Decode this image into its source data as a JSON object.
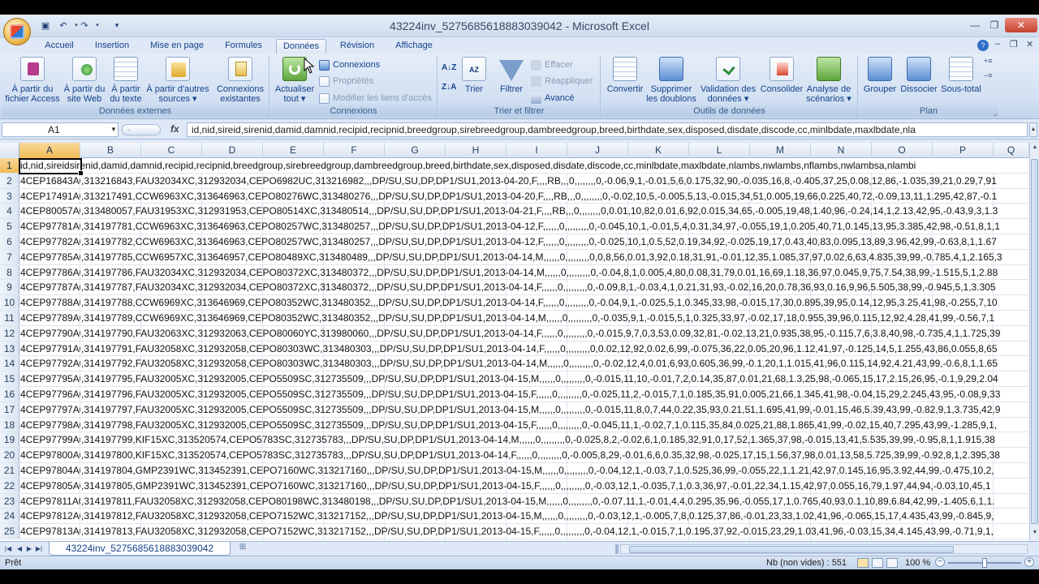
{
  "window": {
    "title": "43224inv_5275685618883039042 - Microsoft Excel"
  },
  "tabs": [
    {
      "label": "Accueil"
    },
    {
      "label": "Insertion"
    },
    {
      "label": "Mise en page"
    },
    {
      "label": "Formules"
    },
    {
      "label": "Données",
      "active": true
    },
    {
      "label": "Révision"
    },
    {
      "label": "Affichage"
    }
  ],
  "ribbon": {
    "external": {
      "label": "Données externes",
      "access": "À partir du fichier Access",
      "access_l1": "À partir du",
      "access_l2": "fichier Access",
      "web_l1": "À partir du",
      "web_l2": "site Web",
      "text_l1": "À partir",
      "text_l2": "du texte",
      "other_l1": "À partir d'autres",
      "other_l2": "sources ▾",
      "existing_l1": "Connexions",
      "existing_l2": "existantes"
    },
    "connections": {
      "label": "Connexions",
      "refresh_l1": "Actualiser",
      "refresh_l2": "tout ▾",
      "connections": "Connexions",
      "properties": "Propriétés",
      "edit_links": "Modifier les liens d'accès"
    },
    "sort_filter": {
      "label": "Trier et filtrer",
      "sort": "Trier",
      "filter": "Filtrer",
      "clear": "Effacer",
      "reapply": "Réappliquer",
      "advanced": "Avancé"
    },
    "data_tools": {
      "label": "Outils de données",
      "convert": "Convertir",
      "remove_dup_l1": "Supprimer",
      "remove_dup_l2": "les doublons",
      "validation_l1": "Validation des",
      "validation_l2": "données ▾",
      "consolidate": "Consolider",
      "whatif_l1": "Analyse de",
      "whatif_l2": "scénarios ▾"
    },
    "outline": {
      "label": "Plan",
      "group": "Grouper",
      "ungroup": "Dissocier",
      "subtotal": "Sous-total"
    }
  },
  "formula_bar": {
    "name_box": "A1",
    "fx": "fx",
    "formula": "id,nid,sireid,sirenid,damid,damnid,recipid,recipnid,breedgroup,sirebreedgroup,dambreedgroup,breed,birthdate,sex,disposed,disdate,discode,cc,minlbdate,maxlbdate,nla"
  },
  "columns": [
    "A",
    "B",
    "C",
    "D",
    "E",
    "F",
    "G",
    "H",
    "I",
    "J",
    "K",
    "L",
    "M",
    "N",
    "O",
    "P",
    "Q"
  ],
  "rows": [
    {
      "n": "1",
      "a": "id,nid,sireid",
      "rest": "sirenid,damid,damnid,recipid,recipnid,breedgroup,sirebreedgroup,dambreedgroup,breed,birthdate,sex,disposed,disdate,discode,cc,minlbdate,maxlbdate,nlambs,nwlambs,nflambs,nwlambsa,nlambi"
    },
    {
      "n": "2",
      "a": "4CEP16843A0",
      "rest": ",313216843,FAU32034XC,312932034,CEPO6982UC,313216982,,,DP/SU,SU,DP,DP1/SU1,2013-04-20,F,,,,RB,,,0,,,,,,,,0,-0.06,9,1,-0.01,5,6,0.175,32,90,-0.035,16,8,-0.405,37,25,0.08,12,86,-1.035,39,21,0.29,7,91"
    },
    {
      "n": "3",
      "a": "4CEP17491A0",
      "rest": ",313217491,CCW6963XC,313646963,CEPO80276WC,313480276,,,DP/SU,SU,DP,DP1/SU1,2013-04-20,F,,,,RB,,,0,,,,,,,,0,-0.02,10,5,-0.005,5,13,-0.015,34,51,0.005,19,66,0.225,40,72,-0.09,13,11,1.295,42,87,-0.1"
    },
    {
      "n": "4",
      "a": "4CEP80057A0",
      "rest": ",313480057,FAU31953XC,312931953,CEPO80514XC,313480514,,,DP/SU,SU,DP,DP1/SU1,2013-04-21,F,,,,RB,,,0,,,,,,,,0,0.01,10,82,0.01,6,92,0.015,34,65,-0.005,19,48,1.40,96,-0.24,14,1,2.13,42,95,-0.43,9,3,1.3"
    },
    {
      "n": "5",
      "a": "4CEP97781A0",
      "rest": ",314197781,CCW6963XC,313646963,CEPO80257WC,313480257,,,DP/SU,SU,DP,DP1/SU1,2013-04-12,F,,,,,,0,,,,,,,,,0,-0.045,10,1,-0.01,5,4,0.31,34,97,-0.055,19,1,0.205,40,71,0.145,13,95,3.385,42,98,-0.51,8,1,1"
    },
    {
      "n": "6",
      "a": "4CEP97782A0",
      "rest": ",314197782,CCW6963XC,313646963,CEPO80257WC,313480257,,,DP/SU,SU,DP,DP1/SU1,2013-04-12,F,,,,,,0,,,,,,,,,0,-0.025,10,1,0.5,52,0.19,34,92,-0.025,19,17,0.43,40,83,0.095,13,89,3.96,42,99,-0.63,8,1,1.67"
    },
    {
      "n": "7",
      "a": "4CEP97785A0",
      "rest": ",314197785,CCW6957XC,313646957,CEPO80489XC,313480489,,,DP/SU,SU,DP,DP1/SU1,2013-04-14,M,,,,,,0,,,,,,,,,0,0,8,56,0.01,3,92,0.18,31,91,-0.01,12,35,1.085,37,97,0.02,6,63,4.835,39,99,-0.785,4,1,2.165,3"
    },
    {
      "n": "8",
      "a": "4CEP97786A0",
      "rest": ",314197786,FAU32034XC,312932034,CEPO80372XC,313480372,,,DP/SU,SU,DP,DP1/SU1,2013-04-14,M,,,,,,0,,,,,,,,,0,-0.04,8,1,0.005,4,80,0.08,31,79,0.01,16,69,1.18,36,97,0.045,9,75,7.54,38,99,-1.515,5,1,2.88"
    },
    {
      "n": "9",
      "a": "4CEP97787A0",
      "rest": ",314197787,FAU32034XC,312932034,CEPO80372XC,313480372,,,DP/SU,SU,DP,DP1/SU1,2013-04-14,F,,,,,,0,,,,,,,,,0,-0.09,8,1,-0.03,4,1,0.21,31,93,-0.02,16,20,0.78,36,93,0.16,9,96,5.505,38,99,-0.945,5,1,3.305"
    },
    {
      "n": "10",
      "a": "4CEP97788A0",
      "rest": ",314197788,CCW6969XC,313646969,CEPO80352WC,313480352,,,DP/SU,SU,DP,DP1/SU1,2013-04-14,F,,,,,,0,,,,,,,,,0,-0.04,9,1,-0.025,5,1,0.345,33,98,-0.015,17,30,0.895,39,95,0.14,12,95,3.25,41,98,-0.255,7,10"
    },
    {
      "n": "11",
      "a": "4CEP97789A0",
      "rest": ",314197789,CCW6969XC,313646969,CEPO80352WC,313480352,,,DP/SU,SU,DP,DP1/SU1,2013-04-14,M,,,,,,0,,,,,,,,,0,-0.035,9,1,-0.015,5,1,0.325,33,97,-0.02,17,18,0.955,39,96,0.115,12,92,4.28,41,99,-0.56,7,1"
    },
    {
      "n": "12",
      "a": "4CEP97790A0",
      "rest": ",314197790,FAU32063XC,312932063,CEPO80060YC,313980060,,,DP/SU,SU,DP,DP1/SU1,2013-04-14,F,,,,,,0,,,,,,,,,0,-0.015,9,7,0,3,53,0.09,32,81,-0.02,13,21,0.935,38,95,-0.115,7,6,3.8,40,98,-0.735,4,1,1.725,39"
    },
    {
      "n": "13",
      "a": "4CEP97791A0",
      "rest": ",314197791,FAU32058XC,312932058,CEPO80303WC,313480303,,,DP/SU,SU,DP,DP1/SU1,2013-04-14,F,,,,,,0,,,,,,,,,0,0.02,12,92,0.02,6,99,-0.075,36,22,0.05,20,96,1.12,41,97,-0.125,14,5,1.255,43,86,0.055,8,65"
    },
    {
      "n": "14",
      "a": "4CEP97792A0",
      "rest": ",314197792,FAU32058XC,312932058,CEPO80303WC,313480303,,,DP/SU,SU,DP,DP1/SU1,2013-04-14,M,,,,,,0,,,,,,,,,0,-0.02,12,4,0.01,6,93,0.605,36,99,-0.1,20,1,1.015,41,96,0.115,14,92,4.21,43,99,-0.6,8,1,1.65"
    },
    {
      "n": "15",
      "a": "4CEP97795A0",
      "rest": ",314197795,FAU32005XC,312932005,CEPO5509SC,312735509,,,DP/SU,SU,DP,DP1/SU1,2013-04-15,M,,,,,,0,,,,,,,,,0,-0.015,11,10,-0.01,7,2,0.14,35,87,0.01,21,68,1.3,25,98,-0.065,15,17,2.15,26,95,-0.1,9,29,2.04"
    },
    {
      "n": "16",
      "a": "4CEP97796A0",
      "rest": ",314197796,FAU32005XC,312932005,CEPO5509SC,312735509,,,DP/SU,SU,DP,DP1/SU1,2013-04-15,F,,,,,,0,,,,,,,,,0,-0.025,11,2,-0.015,7,1,0.185,35,91,0.005,21,66,1.345,41,98,-0.04,15,29,2.245,43,95,-0.08,9,33"
    },
    {
      "n": "17",
      "a": "4CEP97797A0",
      "rest": ",314197797,FAU32005XC,312932005,CEPO5509SC,312735509,,,DP/SU,SU,DP,DP1/SU1,2013-04-15,M,,,,,,0,,,,,,,,,0,-0.015,11,8,0,7,44,0.22,35,93,0.21,51,1.695,41,99,-0.01,15,46,5.39,43,99,-0.82,9,1,3.735,42,9"
    },
    {
      "n": "18",
      "a": "4CEP97798A0",
      "rest": ",314197798,FAU32005XC,312932005,CEPO5509SC,312735509,,,DP/SU,SU,DP,DP1/SU1,2013-04-15,F,,,,,,0,,,,,,,,,0,-0.045,11,1,-0.02,7,1,0.115,35,84,0.025,21,88,1.865,41,99,-0.02,15,40,7.295,43,99,-1.285,9,1,"
    },
    {
      "n": "19",
      "a": "4CEP97799A0",
      "rest": ",314197799,KIF15XC,313520574,CEPO5783SC,312735783,,,DP/SU,SU,DP,DP1/SU1,2013-04-14,M,,,,,,0,,,,,,,,,0,-0.025,8,2,-0.02,6,1,0.185,32,91,0,17,52,1.365,37,98,-0.015,13,41,5.535,39,99,-0.95,8,1,1.915,38"
    },
    {
      "n": "20",
      "a": "4CEP97800A0",
      "rest": ",314197800,KIF15XC,313520574,CEPO5783SC,312735783,,,DP/SU,SU,DP,DP1/SU1,2013-04-14,F,,,,,,0,,,,,,,,,0,-0.005,8,29,-0.01,6,6,0.35,32,98,-0.025,17,15,1.56,37,98,0.01,13,58,5.725,39,99,-0.92,8,1,2.395,38"
    },
    {
      "n": "21",
      "a": "4CEP97804A0",
      "rest": ",314197804,GMP2391WC,313452391,CEPO7160WC,313217160,,,DP/SU,SU,DP,DP1/SU1,2013-04-15,M,,,,,,0,,,,,,,,,0,-0.04,12,1,-0.03,7,1,0.525,36,99,-0.055,22,1,1.21,42,97,0.145,16,95,3.92,44,99,-0.475,10,2,"
    },
    {
      "n": "22",
      "a": "4CEP97805A0",
      "rest": ",314197805,GMP2391WC,313452391,CEPO7160WC,313217160,,,DP/SU,SU,DP,DP1/SU1,2013-04-15,F,,,,,,0,,,,,,,,,0,-0.03,12,1,-0.035,7,1,0.3,36,97,-0.01,22,34,1.15,42,97,0.055,16,79,1.97,44,94,-0.03,10,45,1"
    },
    {
      "n": "23",
      "a": "4CEP97811A0",
      "rest": ",314197811,FAU32058XC,312932058,CEPO80198WC,313480198,,,DP/SU,SU,DP,DP1/SU1,2013-04-15,M,,,,,,0,,,,,,,,,0,-0.07,11,1,-0.01,4,4,0.295,35,96,-0.055,17,1,0.765,40,93,0.1,10,89,6.84,42,99,-1.405,6,1,1."
    },
    {
      "n": "24",
      "a": "4CEP97812A0",
      "rest": ",314197812,FAU32058XC,312932058,CEPO7152WC,313217152,,,DP/SU,SU,DP,DP1/SU1,2013-04-15,M,,,,,,0,,,,,,,,,0,-0.03,12,1,-0.005,7,8,0.125,37,86,-0.01,23,33,1.02,41,96,-0.065,15,17,4.435,43,99,-0.845,9,"
    },
    {
      "n": "25",
      "a": "4CEP97813A0",
      "rest": ",314197813,FAU32058XC,312932058,CEPO7152WC,313217152,,,DP/SU,SU,DP,DP1/SU1,2013-04-15,F,,,,,,0,,,,,,,,,0,-0.04,12,1,-0.015,7,1,0.195,37,92,-0.015,23,29,1.03,41,96,-0.03,15,34,4.145,43,99,-0.71,9,1,"
    }
  ],
  "sheet": {
    "tab_name": "43224inv_5275685618883039042"
  },
  "status": {
    "ready": "Prêt",
    "count": "Nb (non vides) : 551",
    "zoom": "100 %"
  }
}
